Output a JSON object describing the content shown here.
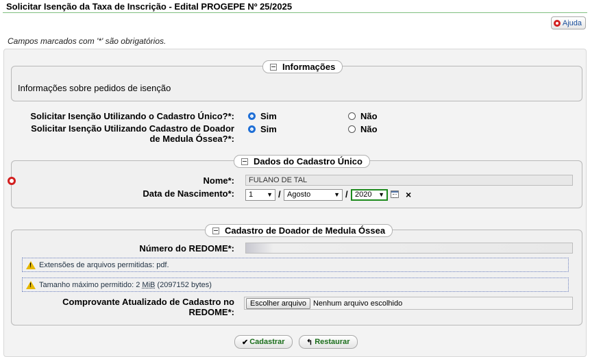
{
  "page": {
    "title": "Solicitar Isenção da Taxa de Inscrição - Edital PROGEPE Nº 25/2025",
    "help_label": "Ajuda",
    "required_note": "Campos marcados com '*' são obrigatórios."
  },
  "informacoes": {
    "legend": "Informações",
    "text": "Informações sobre pedidos de isenção"
  },
  "cad_unico_question": {
    "label": "Solicitar Isenção Utilizando o Cadastro Único?*:",
    "options": [
      "Sim",
      "Não"
    ],
    "selected": "Sim"
  },
  "medula_question": {
    "label_line1": "Solicitar Isenção Utilizando Cadastro de Doador",
    "label_line2": "de Medula Óssea?*:",
    "options": [
      "Sim",
      "Não"
    ],
    "selected": "Sim"
  },
  "dados_cadastro_unico": {
    "legend": "Dados do Cadastro Único",
    "nome_label": "Nome*:",
    "nome_value": "FULANO DE TAL",
    "nascimento_label": "Data de Nascimento*:",
    "dia": "1",
    "mes": "Agosto",
    "ano": "2020",
    "separator": "/",
    "clear_symbol": "×"
  },
  "cadastro_medula": {
    "legend": "Cadastro de Doador de Medula Óssea",
    "redome_label": "Número do REDOME*:",
    "redome_value": "",
    "ext_warning": "Extensões de arquivos permitidas: pdf.",
    "size_warning_prefix": "Tamanho máximo permitido: 2 ",
    "size_warning_unit": "MiB",
    "size_warning_suffix": " (2097152 bytes)",
    "comprovante_label_line1": "Comprovante Atualizado de Cadastro no",
    "comprovante_label_line2": "REDOME*:",
    "file_button": "Escolher arquivo",
    "file_status": "Nenhum arquivo escolhido"
  },
  "actions": {
    "submit_icon": "✔",
    "submit_label": "Cadastrar",
    "reset_icon": "↰",
    "reset_label": "Restaurar"
  },
  "colors": {
    "title_rule": "#7fbf7f",
    "radio_selected": "#1f6fd6",
    "action_text": "#1a6d1a",
    "lifebuoy": "#d21f1f"
  }
}
